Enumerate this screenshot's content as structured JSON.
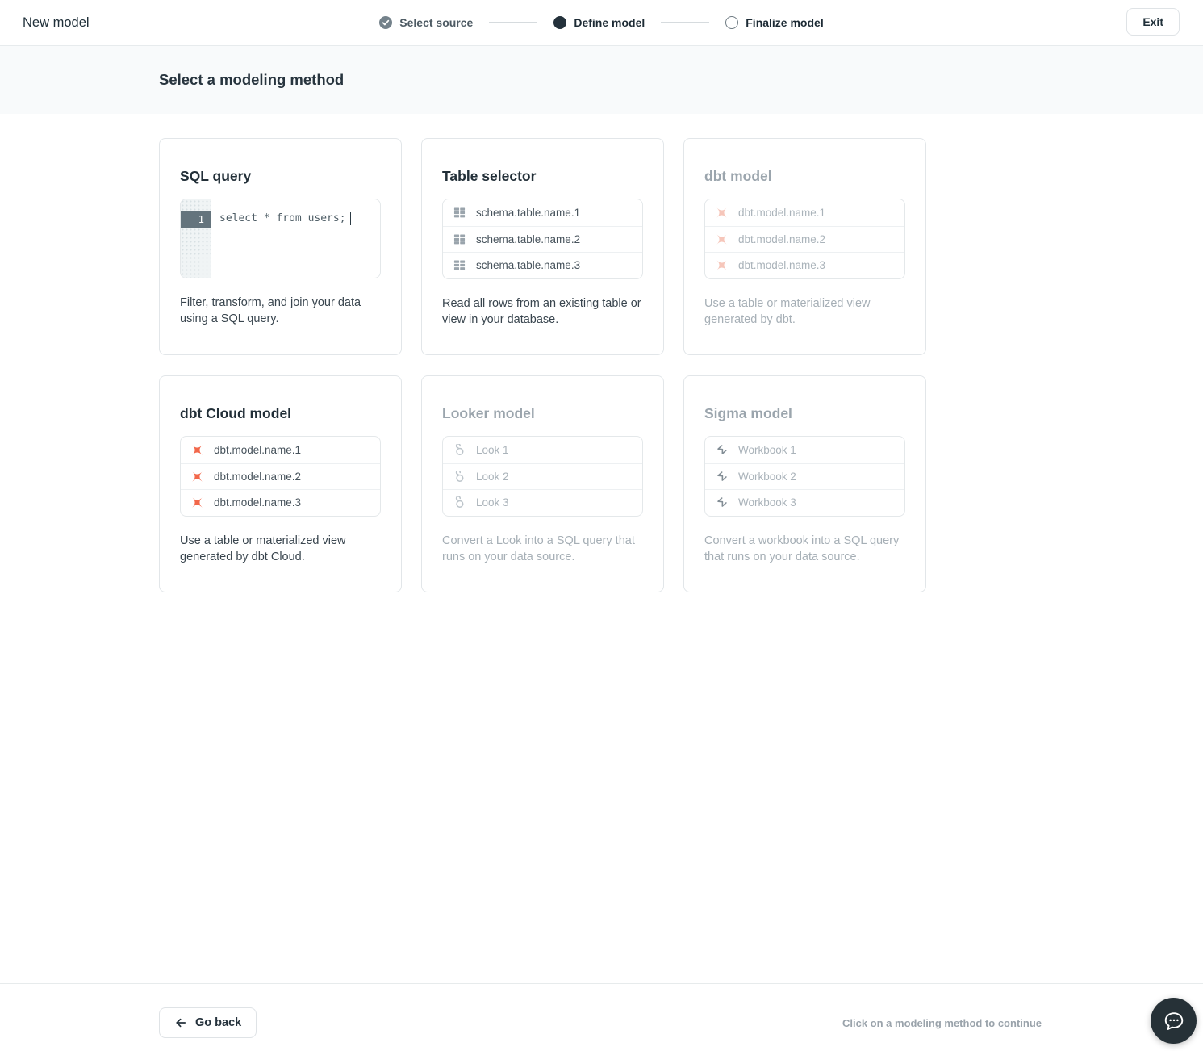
{
  "header": {
    "title": "New model",
    "exit_label": "Exit",
    "steps": [
      {
        "label": "Select source",
        "state": "complete"
      },
      {
        "label": "Define model",
        "state": "current"
      },
      {
        "label": "Finalize model",
        "state": "upcoming"
      }
    ]
  },
  "subheader": {
    "title": "Select a modeling method"
  },
  "cards": [
    {
      "id": "sql-query",
      "title": "SQL query",
      "disabled": false,
      "type": "code",
      "code": {
        "line_number": "1",
        "text": "select * from users;"
      },
      "description": "Filter, transform, and join your data using a SQL query."
    },
    {
      "id": "table-selector",
      "title": "Table selector",
      "disabled": false,
      "type": "list",
      "icon": "table-icon",
      "items": [
        "schema.table.name.1",
        "schema.table.name.2",
        "schema.table.name.3"
      ],
      "description": "Read all rows from an existing table or view in your database."
    },
    {
      "id": "dbt-model",
      "title": "dbt model",
      "disabled": true,
      "type": "list",
      "icon": "dbt-icon",
      "items": [
        "dbt.model.name.1",
        "dbt.model.name.2",
        "dbt.model.name.3"
      ],
      "description": "Use a table or materialized view generated by dbt."
    },
    {
      "id": "dbt-cloud-model",
      "title": "dbt Cloud model",
      "disabled": false,
      "type": "list",
      "icon": "dbt-icon",
      "items": [
        "dbt.model.name.1",
        "dbt.model.name.2",
        "dbt.model.name.3"
      ],
      "description": "Use a table or materialized view generated by dbt Cloud."
    },
    {
      "id": "looker-model",
      "title": "Looker model",
      "disabled": true,
      "type": "list",
      "icon": "looker-icon",
      "items": [
        "Look 1",
        "Look 2",
        "Look 3"
      ],
      "description": "Convert a Look into a SQL query that runs on your data source."
    },
    {
      "id": "sigma-model",
      "title": "Sigma model",
      "disabled": true,
      "type": "list",
      "icon": "sigma-icon",
      "items": [
        "Workbook 1",
        "Workbook 2",
        "Workbook 3"
      ],
      "description": "Convert a workbook into a SQL query that runs on your data source."
    }
  ],
  "footer": {
    "back_label": "Go back",
    "hint": "Click on a modeling method to continue"
  },
  "colors": {
    "dbt_orange": "#f2674a",
    "dbt_orange_faded": "#f6c6ba",
    "icon_gray": "#9aa4ac",
    "dark_text": "#1f2d36",
    "disabled_text": "#aab3ba",
    "chat_bg": "#263137"
  }
}
